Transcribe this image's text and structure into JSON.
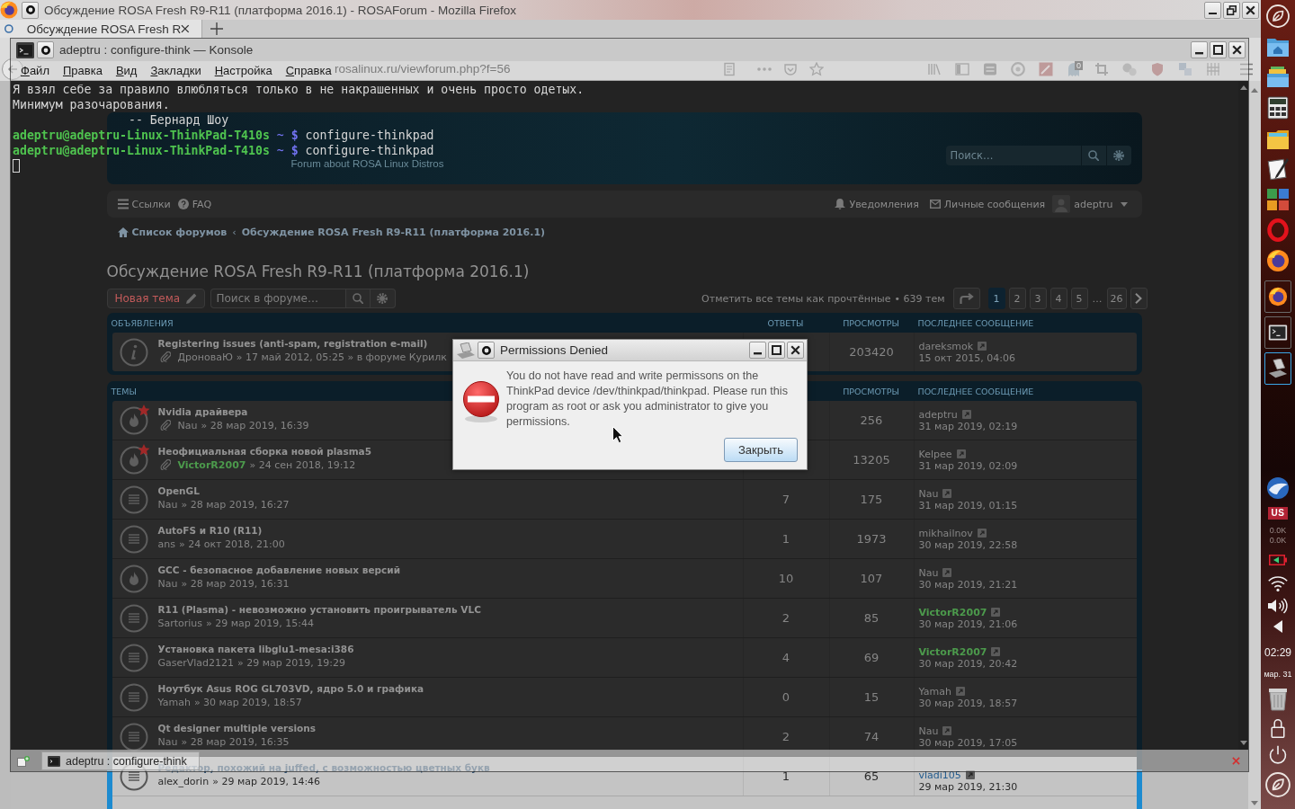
{
  "firefox": {
    "title": "Обсуждение ROSA Fresh R9-R11 (платформа 2016.1) - ROSAForum - Mozilla Firefox",
    "tabs": [
      {
        "label": "Обсуждение ROSA Fresh R",
        "selected": true
      }
    ],
    "address": "rosalinux.ru/viewforum.php?f=56",
    "toolbar_badge": "0"
  },
  "forum": {
    "site_description": "Forum about ROSA Linux Distros",
    "search_placeholder": "Поиск…",
    "quick_links": "Ссылки",
    "faq": "FAQ",
    "notifications": "Уведомления",
    "messages": "Личные сообщения",
    "username": "adeptru",
    "breadcrumbs": [
      "Список форумов",
      "Обсуждение ROSA Fresh R9-R11 (платформа 2016.1)"
    ],
    "breadcrumb_separator": "‹",
    "title": "Обсуждение ROSA Fresh R9-R11 (платформа 2016.1)",
    "new_topic": "Новая тема",
    "forum_search_placeholder": "Поиск в форуме…",
    "mark_read": "Отметить все темы как прочтённые",
    "topic_count": "• 639 тем",
    "pagination": [
      {
        "kind": "page",
        "label": "1",
        "selected": true
      },
      {
        "kind": "page",
        "label": "2",
        "selected": false
      },
      {
        "kind": "page",
        "label": "3",
        "selected": false
      },
      {
        "kind": "page",
        "label": "4",
        "selected": false
      },
      {
        "kind": "page",
        "label": "5",
        "selected": false
      },
      {
        "kind": "ellipsis",
        "label": "…"
      },
      {
        "kind": "page",
        "label": "26",
        "selected": false
      }
    ],
    "announcements": {
      "heading": "ОБЪЯВЛЕНИЯ",
      "columns": {
        "replies": "ОТВЕТЫ",
        "views": "ПРОСМОТРЫ",
        "last_post": "ПОСЛЕДНЕЕ СООБЩЕНИЕ"
      },
      "rows": [
        {
          "kind": "announcement",
          "starred": false,
          "attachment": true,
          "title": "Registering issues (anti-spam, registration e-mail)",
          "author": {
            "name": "ДроноваЮ"
          },
          "time": "» 17 май 2012, 05:25 » в форуме Курилк",
          "views": "203420",
          "last_post": {
            "author": {
              "name": "dareksmok"
            },
            "time": "15 окт 2015, 04:06"
          }
        }
      ]
    },
    "topics": {
      "heading": "ТЕМЫ",
      "columns": {
        "views": "ПРОСМОТРЫ",
        "last_post": "ПОСЛЕДНЕЕ СООБЩЕНИЕ"
      },
      "rows": [
        {
          "kind": "hot",
          "starred": true,
          "attachment": true,
          "title": "Nvidia драйвера",
          "author": {
            "name": "Nau"
          },
          "time": "» 28 мар 2019, 16:39",
          "views": "256",
          "last_post": {
            "author": {
              "name": "adeptru"
            },
            "time": "31 мар 2019, 02:19"
          }
        },
        {
          "kind": "hot",
          "starred": true,
          "attachment": true,
          "title": "Неофициальная сборка новой plasma5",
          "author": {
            "name": "VictorR2007",
            "color": "#4c9a4c"
          },
          "time": "» 24 сен 2018, 19:12",
          "views": "13205",
          "last_post": {
            "author": {
              "name": "Kelpee"
            },
            "time": "31 мар 2019, 02:09"
          }
        },
        {
          "kind": "normal",
          "starred": false,
          "attachment": false,
          "title": "OpenGL",
          "author": {
            "name": "Nau"
          },
          "time": "» 28 мар 2019, 16:27",
          "replies": "7",
          "views": "175",
          "last_post": {
            "author": {
              "name": "Nau"
            },
            "time": "31 мар 2019, 01:15"
          }
        },
        {
          "kind": "normal",
          "starred": false,
          "attachment": false,
          "title": "AutoFS и R10 (R11)",
          "author": {
            "name": "ans"
          },
          "time": "» 24 окт 2018, 21:00",
          "replies": "1",
          "views": "1973",
          "last_post": {
            "author": {
              "name": "mikhailnov"
            },
            "time": "30 мар 2019, 22:58"
          }
        },
        {
          "kind": "hot",
          "starred": false,
          "attachment": false,
          "title": "GCC - безопасное добавление новых версий",
          "author": {
            "name": "Nau"
          },
          "time": "» 28 мар 2019, 16:31",
          "replies": "10",
          "views": "107",
          "last_post": {
            "author": {
              "name": "Nau"
            },
            "time": "30 мар 2019, 21:21"
          }
        },
        {
          "kind": "normal",
          "starred": false,
          "attachment": false,
          "title": "R11 (Plasma) - невозможно установить проигрыватель VLC",
          "author": {
            "name": "Sartorius"
          },
          "time": "» 29 мар 2019, 15:44",
          "replies": "2",
          "views": "85",
          "last_post": {
            "author": {
              "name": "VictorR2007",
              "color": "#4c9a4c"
            },
            "time": "30 мар 2019, 21:06"
          }
        },
        {
          "kind": "normal",
          "starred": false,
          "attachment": false,
          "title": "Установка пакета libglu1-mesa:i386",
          "author": {
            "name": "GaserVlad2121"
          },
          "time": "» 29 мар 2019, 19:29",
          "replies": "4",
          "views": "69",
          "last_post": {
            "author": {
              "name": "VictorR2007",
              "color": "#4c9a4c"
            },
            "time": "30 мар 2019, 20:42"
          }
        },
        {
          "kind": "normal",
          "starred": false,
          "attachment": false,
          "title": "Ноутбук Asus ROG GL703VD, ядро 5.0 и графика",
          "author": {
            "name": "Yamah"
          },
          "time": "» 30 мар 2019, 18:57",
          "replies": "0",
          "views": "15",
          "last_post": {
            "author": {
              "name": "Yamah"
            },
            "time": "30 мар 2019, 18:57"
          }
        },
        {
          "kind": "normal",
          "starred": false,
          "attachment": false,
          "title": "Qt designer multiple versions",
          "author": {
            "name": "Nau"
          },
          "time": "» 28 мар 2019, 16:35",
          "replies": "2",
          "views": "74",
          "last_post": {
            "author": {
              "name": "Nau"
            },
            "time": "30 мар 2019, 17:05"
          }
        },
        {
          "kind": "normal",
          "starred": false,
          "attachment": false,
          "title": "Редактор, похожий на juffed, с возможностью цветных букв",
          "author": {
            "name": "alex_dorin"
          },
          "time": "» 29 мар 2019, 14:46",
          "replies": "1",
          "views": "65",
          "last_post": {
            "author": {
              "name": "vladi105"
            },
            "time": "29 мар 2019, 21:30"
          }
        }
      ]
    }
  },
  "konsole": {
    "title": "adeptru : configure-think — Konsole",
    "menu": [
      "Файл",
      "Правка",
      "Вид",
      "Закладки",
      "Настройка",
      "Справка"
    ],
    "lines": [
      {
        "kind": "output",
        "text": "Я взял себе за правило влюбляться только в не накрашенных и очень просто одетых."
      },
      {
        "kind": "output",
        "text": "Минимум разочарования."
      },
      {
        "kind": "attribution",
        "text": "-- Бернард Шоу"
      },
      {
        "kind": "prompt",
        "user_host": "adeptru@adeptru-Linux-ThinkPad-T410s",
        "path": "~",
        "symbol": "$",
        "command": "configure-thinkpad"
      },
      {
        "kind": "prompt",
        "user_host": "adeptru@adeptru-Linux-ThinkPad-T410s",
        "path": "~",
        "symbol": "$",
        "command": "configure-thinkpad"
      }
    ],
    "tabs": [
      {
        "label": "adeptru : configure-think",
        "selected": true
      }
    ]
  },
  "dialog": {
    "title": "Permissions Denied",
    "message": "You do not have read and write permissons on the ThinkPad device /dev/thinkpad/thinkpad. Please run this program as root or ask you administrator to give you permissions.",
    "button": "Закрыть"
  },
  "dock": {
    "taskbar": [
      {
        "kind": "browser",
        "selected": false
      },
      {
        "kind": "terminal",
        "selected": false
      },
      {
        "kind": "laptop",
        "selected": true
      }
    ],
    "keyboard_layout": "US",
    "net_down": "0.0K",
    "net_up": "0.0K",
    "time": "02:29",
    "date": "мар. 31"
  }
}
